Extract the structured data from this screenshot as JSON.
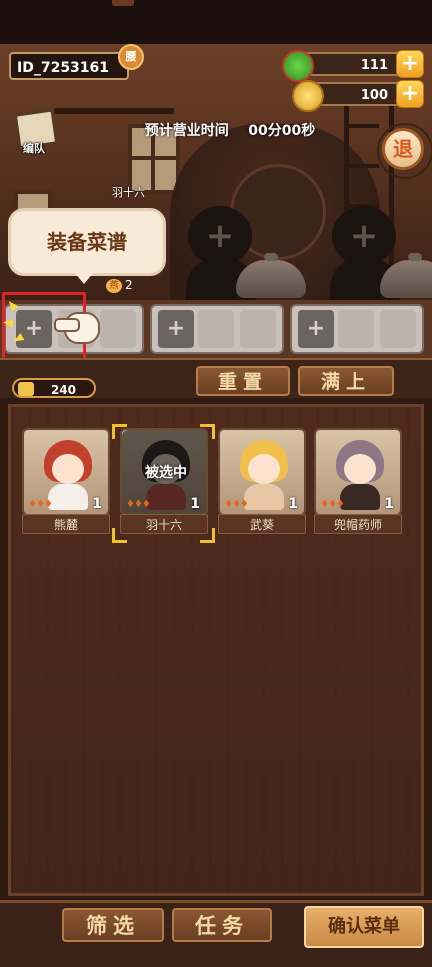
{
  "header": {
    "player_id": "ID_7253161",
    "id_badge": "腰",
    "resources": [
      {
        "name": "gems",
        "icon": "green-gem-icon",
        "value": "111"
      },
      {
        "name": "coins",
        "icon": "gold-coin-icon",
        "value": "100"
      }
    ]
  },
  "scene": {
    "team_label": "编队",
    "business_time_label": "预计营业时间",
    "business_time_value": "00分00秒",
    "exit_label": "退",
    "character_name": "羽十六",
    "bubble_text": "装备菜谱",
    "recipe_count": "2",
    "recipe_icon_text": "燕"
  },
  "recipe_slots": {
    "groups": 3,
    "add_symbol": "+"
  },
  "controls": {
    "coin_count": "240",
    "reset_label": "重置",
    "fill_label": "满上"
  },
  "roster": {
    "selected_label": "被选中",
    "chefs": [
      {
        "name": "熊麓",
        "level": "1",
        "stars": "♦♦♦",
        "selected": false
      },
      {
        "name": "羽十六",
        "level": "1",
        "stars": "♦♦♦",
        "selected": true
      },
      {
        "name": "武葵",
        "level": "1",
        "stars": "♦♦♦",
        "selected": false
      },
      {
        "name": "兜帽药师",
        "level": "1",
        "stars": "♦♦♦",
        "selected": false
      }
    ]
  },
  "footer": {
    "filter_label": "筛选",
    "task_label": "任务",
    "confirm_label": "确认菜单"
  },
  "colors": {
    "accent_gold": "#f0a020",
    "highlight_red": "#e0222a",
    "panel_brown": "#4e2b1d"
  }
}
